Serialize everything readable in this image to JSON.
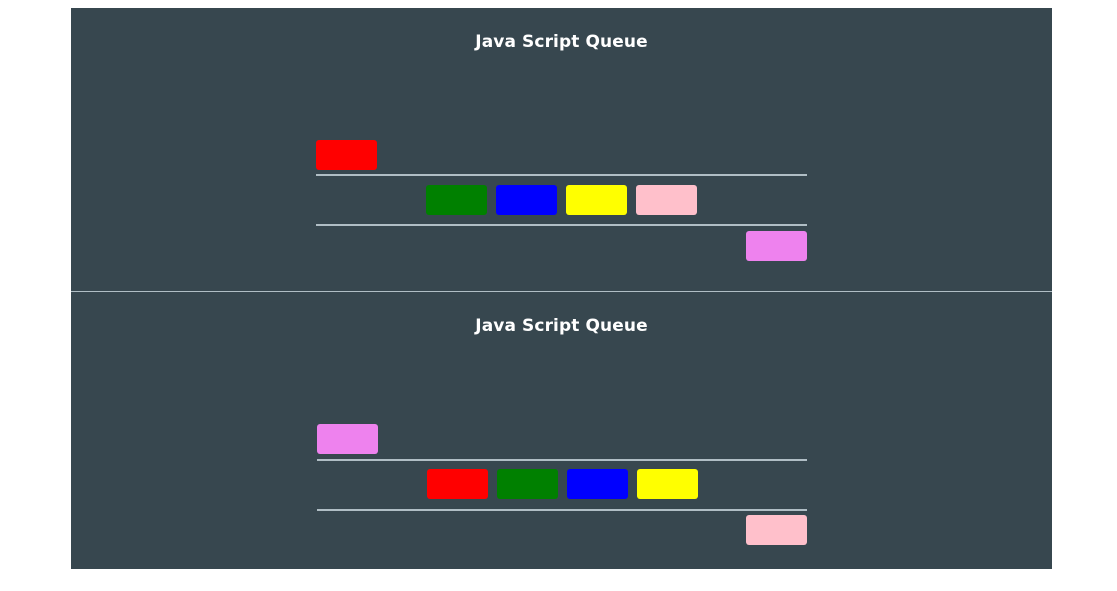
{
  "colors": {
    "background": "#37474f",
    "rail": "#b0bec5",
    "title_text": "#ffffff"
  },
  "queues": [
    {
      "title": "Java Script Queue",
      "incoming": {
        "color": "#ff0000"
      },
      "items": [
        {
          "color": "#008000"
        },
        {
          "color": "#0000ff"
        },
        {
          "color": "#ffff00"
        },
        {
          "color": "#ffc0cb"
        }
      ],
      "outgoing": {
        "color": "#ee82ee"
      }
    },
    {
      "title": "Java Script Queue",
      "incoming": {
        "color": "#ee82ee"
      },
      "items": [
        {
          "color": "#ff0000"
        },
        {
          "color": "#008000"
        },
        {
          "color": "#0000ff"
        },
        {
          "color": "#ffff00"
        }
      ],
      "outgoing": {
        "color": "#ffc0cb"
      }
    }
  ]
}
